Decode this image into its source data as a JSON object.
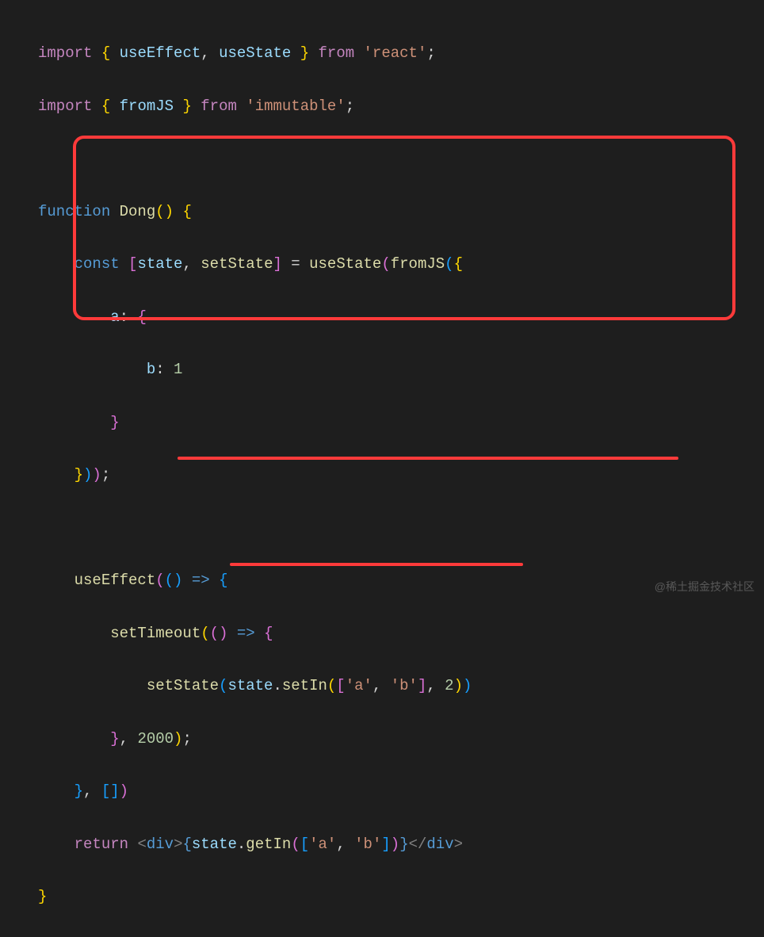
{
  "code": {
    "line1": {
      "import": "import",
      "lb": "{",
      "use_effect": "useEffect",
      "comma": ",",
      "use_state": "useState",
      "rb": "}",
      "from": "from",
      "react": "'react'",
      "semi": ";"
    },
    "line2": {
      "import": "import",
      "lb": "{",
      "fromjs": "fromJS",
      "rb": "}",
      "from": "from",
      "immutable": "'immutable'",
      "semi": ";"
    },
    "line4": {
      "function": "function",
      "name": "Dong",
      "lp": "(",
      "rp": ")",
      "lb": "{"
    },
    "line5": {
      "const": "const",
      "lb": "[",
      "state": "state",
      "comma": ",",
      "setstate": "setState",
      "rb": "]",
      "eq": "=",
      "usestate": "useState",
      "lp": "(",
      "fromjs": "fromJS",
      "lp2": "(",
      "lb2": "{"
    },
    "line6": {
      "a": "a",
      "colon": ":",
      "lb": "{"
    },
    "line7": {
      "b": "b",
      "colon": ":",
      "one": "1"
    },
    "line8": {
      "rb": "}"
    },
    "line9": {
      "rb": "}",
      "rp": ")",
      "rp2": ")",
      "semi": ";"
    },
    "line11": {
      "useeffect": "useEffect",
      "lp": "(",
      "lp2": "(",
      "rp": ")",
      "arrow": "=>",
      "lb": "{"
    },
    "line12": {
      "settimeout": "setTimeout",
      "lp": "(",
      "lp2": "(",
      "rp": ")",
      "arrow": "=>",
      "lb": "{"
    },
    "line13": {
      "setstate": "setState",
      "lp": "(",
      "state": "state",
      "dot": ".",
      "setin": "setIn",
      "lp2": "(",
      "lb": "[",
      "a": "'a'",
      "comma": ",",
      "b": "'b'",
      "rb": "]",
      "comma2": ",",
      "two": "2",
      "rp": ")",
      "rp2": ")"
    },
    "line14": {
      "rb": "}",
      "comma": ",",
      "timeout": "2000",
      "rp": ")",
      "semi": ";"
    },
    "line15": {
      "rb": "}",
      "comma": ",",
      "lb": "[",
      "rb2": "]",
      "rp": ")"
    },
    "line16": {
      "return": "return",
      "lt": "<",
      "div": "div",
      "gt": ">",
      "lb": "{",
      "state": "state",
      "dot": ".",
      "getin": "getIn",
      "lp": "(",
      "lb2": "[",
      "a": "'a'",
      "comma": ",",
      "b": "'b'",
      "rb2": "]",
      "rp": ")",
      "rb": "}",
      "lt2": "</",
      "div2": "div",
      "gt2": ">"
    },
    "line17": {
      "rb": "}"
    }
  },
  "watermark": "@稀土掘金技术社区"
}
